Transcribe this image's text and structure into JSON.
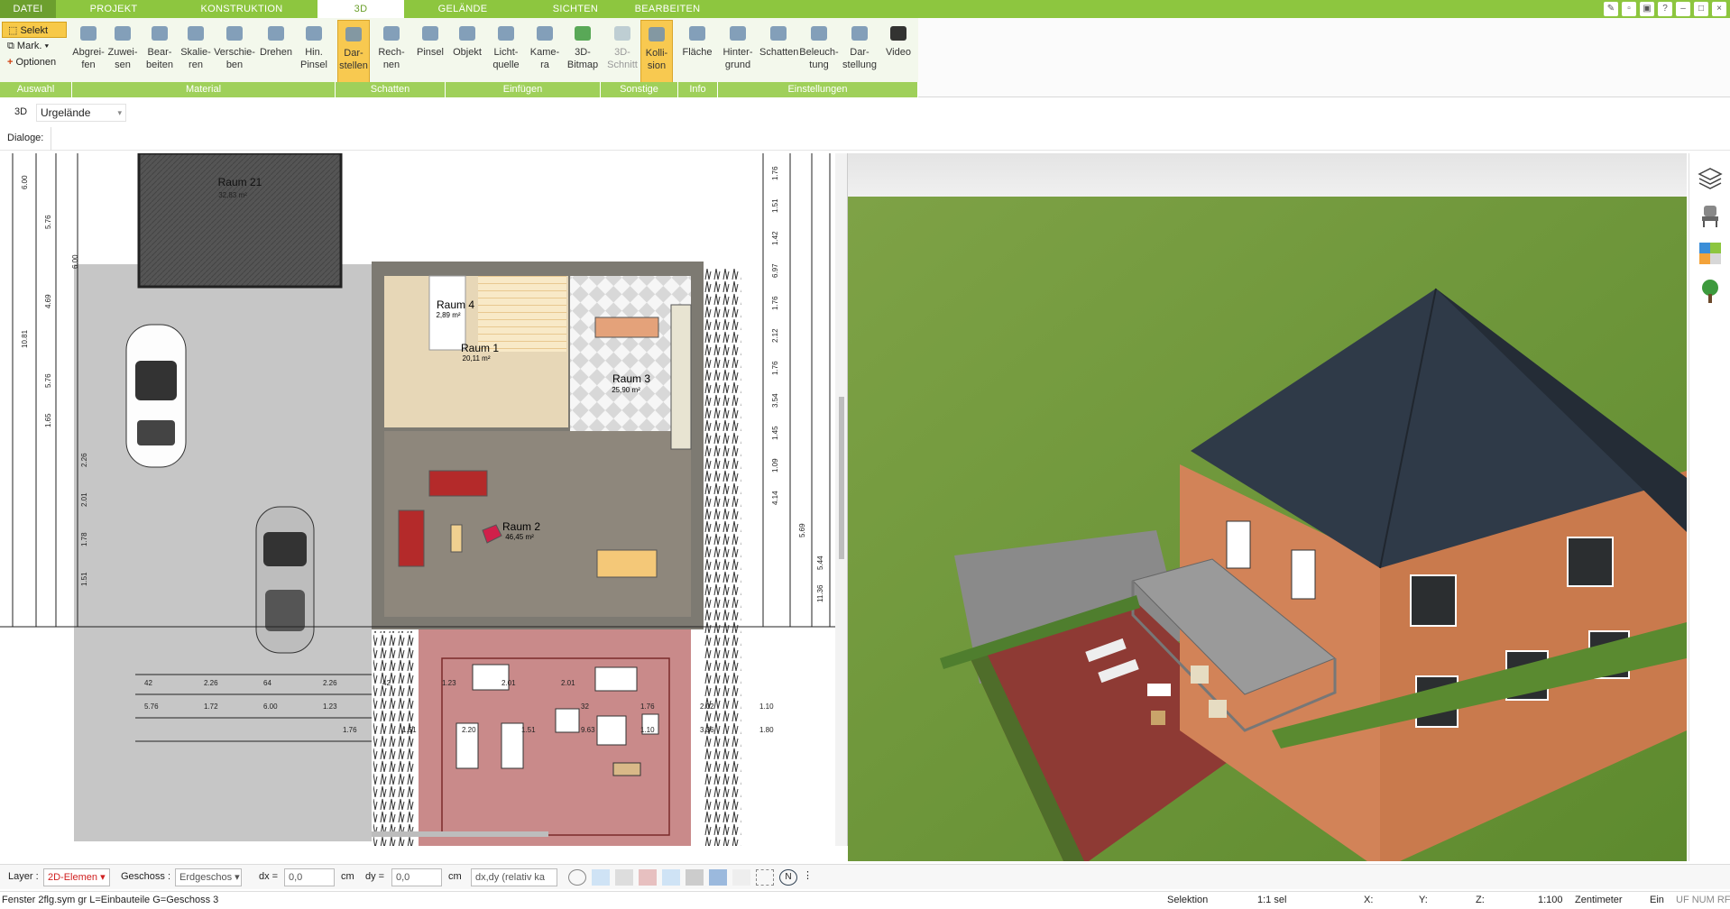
{
  "tabs": [
    "DATEI",
    "PROJEKT",
    "KONSTRUKTION",
    "3D",
    "GELÄNDE",
    "SICHTEN",
    "BEARBEITEN"
  ],
  "selection": [
    "Selekt",
    "Mark.",
    "Optionen"
  ],
  "ribbon_buttons": [
    {
      "l1": "Abgrei-",
      "l2": "fen"
    },
    {
      "l1": "Zuwei-",
      "l2": "sen"
    },
    {
      "l1": "Bear-",
      "l2": "beiten"
    },
    {
      "l1": "Skalie-",
      "l2": "ren"
    },
    {
      "l1": "Verschie-",
      "l2": "ben"
    },
    {
      "l1": "Drehen",
      "l2": ""
    },
    {
      "l1": "Hin.",
      "l2": "Pinsel"
    },
    {
      "l1": "Dar-",
      "l2": "stellen"
    },
    {
      "l1": "Rech-",
      "l2": "nen"
    },
    {
      "l1": "Pinsel",
      "l2": ""
    },
    {
      "l1": "Objekt",
      "l2": ""
    },
    {
      "l1": "Licht-",
      "l2": "quelle"
    },
    {
      "l1": "Kame-",
      "l2": "ra"
    },
    {
      "l1": "3D-",
      "l2": "Bitmap"
    },
    {
      "l1": "3D-",
      "l2": "Schnitt"
    },
    {
      "l1": "Kolli-",
      "l2": "sion"
    },
    {
      "l1": "Fläche",
      "l2": ""
    },
    {
      "l1": "Hinter-",
      "l2": "grund"
    },
    {
      "l1": "Schatten",
      "l2": ""
    },
    {
      "l1": "Beleuch-",
      "l2": "tung"
    },
    {
      "l1": "Dar-",
      "l2": "stellung"
    },
    {
      "l1": "Video",
      "l2": ""
    }
  ],
  "groups": [
    "Auswahl",
    "Material",
    "Schatten",
    "Einfügen",
    "Sonstige",
    "Info",
    "Einstellungen"
  ],
  "view_mode": "3D",
  "terrain_select": "Urgelände",
  "dialoge_label": "Dialoge:",
  "rooms": [
    {
      "name": "Raum 21",
      "area": "32,83 m²"
    },
    {
      "name": "Raum 4",
      "area": "2,89 m²"
    },
    {
      "name": "Raum 1",
      "area": "20,11 m²"
    },
    {
      "name": "Raum 3",
      "area": "25,90 m²"
    },
    {
      "name": "Raum 2",
      "area": "46,45 m²"
    }
  ],
  "dims_left": [
    "6.00",
    "5.76",
    "6.00",
    "4.69",
    "10.81",
    "5.76",
    "1.65",
    "2.26",
    "2.01",
    "1.78",
    "1.51"
  ],
  "dims_right": [
    "1.76",
    "1.51",
    "1.42",
    "6.97",
    "1.76",
    "2.12",
    "1.76",
    "3.54",
    "1.45",
    "1.09",
    "4.14",
    "5.69",
    "5.44",
    "11.36"
  ],
  "dims_bottom": [
    "42",
    "2.26",
    "64",
    "2.26",
    "42",
    "1.23",
    "2.01",
    "2.01",
    "5.76",
    "1.72",
    "6.00",
    "1.23",
    "32",
    "1.76",
    "2.02",
    "1.10",
    "1.76",
    "1.51",
    "2.20",
    "1.51",
    "9.63",
    "1.10",
    "3.36",
    "1.80"
  ],
  "status": {
    "layer_label": "Layer :",
    "layer_value": "2D-Elemen",
    "geschoss_label": "Geschoss :",
    "geschoss_value": "Erdgeschos",
    "dx_label": "dx =",
    "dx_value": "0,0",
    "dx_unit": "cm",
    "dy_label": "dy =",
    "dy_value": "0,0",
    "dy_unit": "cm",
    "relative": "dx,dy (relativ ka"
  },
  "info": {
    "file": "Fenster 2flg.sym gr L=Einbauteile G=Geschoss 3",
    "mode": "Selektion",
    "sel": "1:1 sel",
    "x": "X:",
    "y": "Y:",
    "z": "Z:",
    "scale": "1:100",
    "unit": "Zentimeter",
    "ein": "Ein",
    "flags": "UF NUM RF"
  },
  "colors": {
    "accent": "#8dc63f",
    "group": "#9fd05a",
    "active_btn": "#f8c950",
    "roof": "#2f3a48",
    "wall": "#d9865c",
    "lawn": "#6f9a3a",
    "terrace": "#9e3b35"
  }
}
